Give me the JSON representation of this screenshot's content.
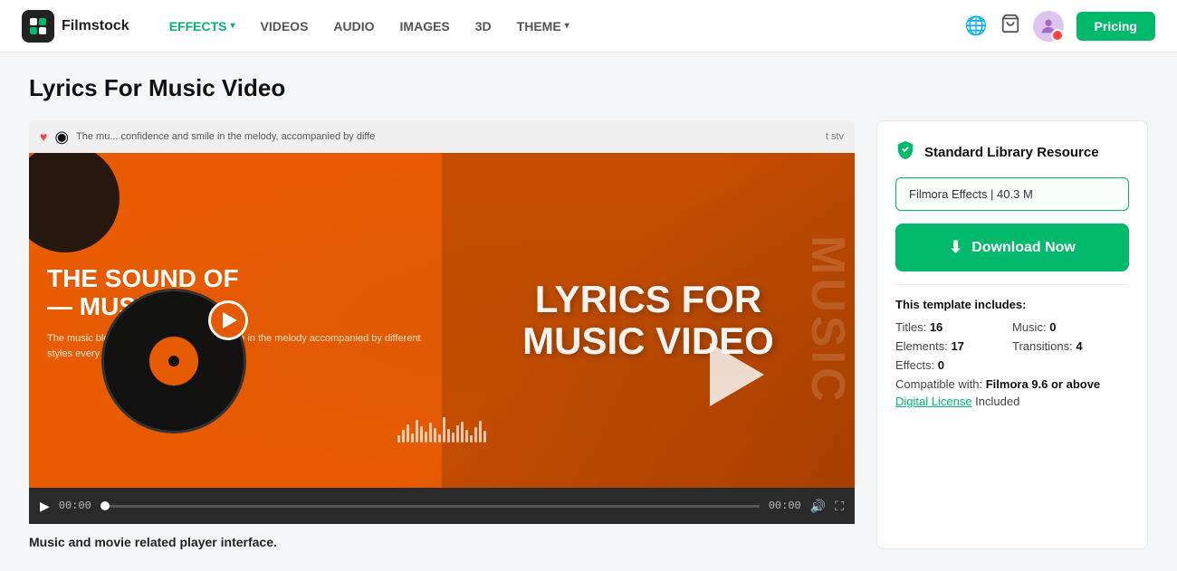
{
  "header": {
    "logo_icon": "🎬",
    "logo_name": "Filmstock",
    "nav": [
      {
        "label": "EFFECTS",
        "id": "effects",
        "active": true,
        "has_dropdown": true
      },
      {
        "label": "VIDEOS",
        "id": "videos",
        "active": false,
        "has_dropdown": false
      },
      {
        "label": "AUDIO",
        "id": "audio",
        "active": false,
        "has_dropdown": false
      },
      {
        "label": "IMAGES",
        "id": "images",
        "active": false,
        "has_dropdown": false
      },
      {
        "label": "3D",
        "id": "3d",
        "active": false,
        "has_dropdown": false
      },
      {
        "label": "THEME",
        "id": "theme",
        "active": false,
        "has_dropdown": true
      }
    ],
    "pricing_label": "Pricing",
    "globe_icon": "🌐",
    "cart_icon": "🛒"
  },
  "page": {
    "title": "Lyrics For Music Video"
  },
  "video": {
    "strip_text": "The mu... confidence and smile in the melody, accompanied by diffe",
    "strip_right": "t stv",
    "heart_icon": "♥",
    "vinyl_icon": "⬤",
    "main_title_line1": "THE SOUND OF",
    "main_title_line2": "— MUSIC",
    "subtitle": "The music blooms with confidence and smile in the melody accompanied by different styles every note is like life jumping",
    "lyrics_big": "LYRICS FOR MUSIC VIDEO",
    "music_side": "MUSIC",
    "time_current": "00:00",
    "time_total": "00:00",
    "caption": "Music and movie related player interface."
  },
  "right_panel": {
    "resource_label": "Standard Library Resource",
    "effects_badge": "Filmora Effects | 40.3 M",
    "download_label": "Download Now",
    "template_includes_label": "This template includes:",
    "titles_label": "Titles:",
    "titles_value": "16",
    "music_label": "Music:",
    "music_value": "0",
    "elements_label": "Elements:",
    "elements_value": "17",
    "transitions_label": "Transitions:",
    "transitions_value": "4",
    "effects_label": "Effects:",
    "effects_value": "0",
    "compatible_label": "Compatible with:",
    "compatible_value": "Filmora 9.6 or above",
    "license_link_text": "Digital License",
    "license_suffix": " Included"
  },
  "colors": {
    "accent": "#00b96b",
    "orange": "#e85b00"
  }
}
